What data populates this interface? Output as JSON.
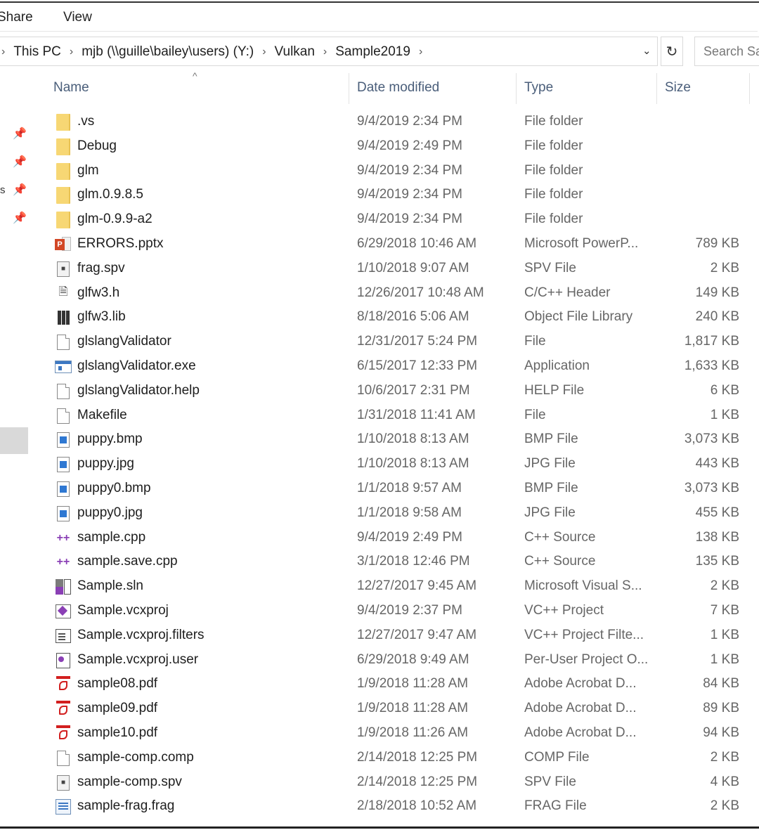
{
  "ribbon": {
    "tabs": [
      "Share",
      "View"
    ]
  },
  "address_bar": {
    "crumbs": [
      "This PC",
      "mjb (\\\\guille\\bailey\\users) (Y:)",
      "Vulkan",
      "Sample2019"
    ],
    "search_placeholder": "Search Sa"
  },
  "nav": {
    "fragment": "s"
  },
  "columns": {
    "name": "Name",
    "date": "Date modified",
    "type": "Type",
    "size": "Size"
  },
  "files": [
    {
      "name": ".vs",
      "date": "9/4/2019 2:34 PM",
      "type": "File folder",
      "size": "",
      "icon": "folder-icon"
    },
    {
      "name": "Debug",
      "date": "9/4/2019 2:49 PM",
      "type": "File folder",
      "size": "",
      "icon": "folder-icon"
    },
    {
      "name": "glm",
      "date": "9/4/2019 2:34 PM",
      "type": "File folder",
      "size": "",
      "icon": "folder-icon"
    },
    {
      "name": "glm.0.9.8.5",
      "date": "9/4/2019 2:34 PM",
      "type": "File folder",
      "size": "",
      "icon": "folder-icon"
    },
    {
      "name": "glm-0.9.9-a2",
      "date": "9/4/2019 2:34 PM",
      "type": "File folder",
      "size": "",
      "icon": "folder-icon"
    },
    {
      "name": "ERRORS.pptx",
      "date": "6/29/2018 10:46 AM",
      "type": "Microsoft PowerP...",
      "size": "789 KB",
      "icon": "powerpoint-icon"
    },
    {
      "name": "frag.spv",
      "date": "1/10/2018 9:07 AM",
      "type": "SPV File",
      "size": "2 KB",
      "icon": "spv-file-icon"
    },
    {
      "name": "glfw3.h",
      "date": "12/26/2017 10:48 AM",
      "type": "C/C++ Header",
      "size": "149 KB",
      "icon": "header-file-icon"
    },
    {
      "name": "glfw3.lib",
      "date": "8/18/2016 5:06 AM",
      "type": "Object File Library",
      "size": "240 KB",
      "icon": "library-icon"
    },
    {
      "name": "glslangValidator",
      "date": "12/31/2017 5:24 PM",
      "type": "File",
      "size": "1,817 KB",
      "icon": "blank-file-icon"
    },
    {
      "name": "glslangValidator.exe",
      "date": "6/15/2017 12:33 PM",
      "type": "Application",
      "size": "1,633 KB",
      "icon": "application-icon"
    },
    {
      "name": "glslangValidator.help",
      "date": "10/6/2017 2:31 PM",
      "type": "HELP File",
      "size": "6 KB",
      "icon": "blank-file-icon"
    },
    {
      "name": "Makefile",
      "date": "1/31/2018 11:41 AM",
      "type": "File",
      "size": "1 KB",
      "icon": "blank-file-icon"
    },
    {
      "name": "puppy.bmp",
      "date": "1/10/2018 8:13 AM",
      "type": "BMP File",
      "size": "3,073 KB",
      "icon": "image-file-icon"
    },
    {
      "name": "puppy.jpg",
      "date": "1/10/2018 8:13 AM",
      "type": "JPG File",
      "size": "443 KB",
      "icon": "image-file-icon"
    },
    {
      "name": "puppy0.bmp",
      "date": "1/1/2018 9:57 AM",
      "type": "BMP File",
      "size": "3,073 KB",
      "icon": "image-file-icon"
    },
    {
      "name": "puppy0.jpg",
      "date": "1/1/2018 9:58 AM",
      "type": "JPG File",
      "size": "455 KB",
      "icon": "image-file-icon"
    },
    {
      "name": "sample.cpp",
      "date": "9/4/2019 2:49 PM",
      "type": "C++ Source",
      "size": "138 KB",
      "icon": "cpp-source-icon"
    },
    {
      "name": "sample.save.cpp",
      "date": "3/1/2018 12:46 PM",
      "type": "C++ Source",
      "size": "135 KB",
      "icon": "cpp-source-icon"
    },
    {
      "name": "Sample.sln",
      "date": "12/27/2017 9:45 AM",
      "type": "Microsoft Visual S...",
      "size": "2 KB",
      "icon": "solution-icon"
    },
    {
      "name": "Sample.vcxproj",
      "date": "9/4/2019 2:37 PM",
      "type": "VC++ Project",
      "size": "7 KB",
      "icon": "vcxproj-icon"
    },
    {
      "name": "Sample.vcxproj.filters",
      "date": "12/27/2017 9:47 AM",
      "type": "VC++ Project Filte...",
      "size": "1 KB",
      "icon": "filters-icon"
    },
    {
      "name": "Sample.vcxproj.user",
      "date": "6/29/2018 9:49 AM",
      "type": "Per-User Project O...",
      "size": "1 KB",
      "icon": "user-project-icon"
    },
    {
      "name": "sample08.pdf",
      "date": "1/9/2018 11:28 AM",
      "type": "Adobe Acrobat D...",
      "size": "84 KB",
      "icon": "pdf-icon"
    },
    {
      "name": "sample09.pdf",
      "date": "1/9/2018 11:28 AM",
      "type": "Adobe Acrobat D...",
      "size": "89 KB",
      "icon": "pdf-icon"
    },
    {
      "name": "sample10.pdf",
      "date": "1/9/2018 11:26 AM",
      "type": "Adobe Acrobat D...",
      "size": "94 KB",
      "icon": "pdf-icon"
    },
    {
      "name": "sample-comp.comp",
      "date": "2/14/2018 12:25 PM",
      "type": "COMP File",
      "size": "2 KB",
      "icon": "blank-file-icon"
    },
    {
      "name": "sample-comp.spv",
      "date": "2/14/2018 12:25 PM",
      "type": "SPV File",
      "size": "4 KB",
      "icon": "spv-file-icon"
    },
    {
      "name": "sample-frag.frag",
      "date": "2/18/2018 10:52 AM",
      "type": "FRAG File",
      "size": "2 KB",
      "icon": "frag-file-icon"
    }
  ]
}
